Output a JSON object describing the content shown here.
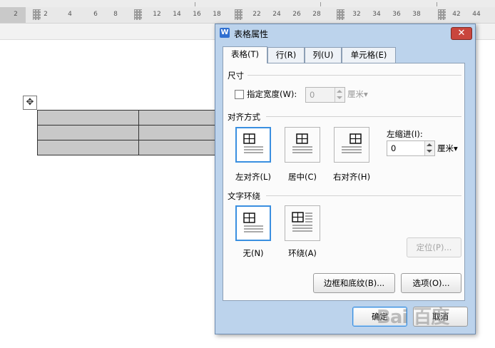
{
  "ruler": {
    "labels": [
      "2",
      "2",
      "4",
      "6",
      "8",
      "12",
      "14",
      "16",
      "18",
      "22",
      "24",
      "26",
      "28",
      "32",
      "34",
      "36",
      "38",
      "42",
      "44"
    ]
  },
  "document": {
    "move_handle_glyph": "✥",
    "table_rows": 3,
    "table_cols": 2
  },
  "dialog": {
    "app_icon": "W",
    "title": "表格属性",
    "close_glyph": "✕",
    "tabs": [
      {
        "label": "表格(T)",
        "active": true
      },
      {
        "label": "行(R)",
        "active": false
      },
      {
        "label": "列(U)",
        "active": false
      },
      {
        "label": "单元格(E)",
        "active": false
      }
    ],
    "size_section": {
      "label": "尺寸",
      "checkbox_label": "指定宽度(W):",
      "width_value": "0",
      "unit": "厘米▾"
    },
    "align_section": {
      "label": "对齐方式",
      "options": [
        {
          "label": "左对齐(L)",
          "selected": true
        },
        {
          "label": "居中(C)",
          "selected": false
        },
        {
          "label": "右对齐(H)",
          "selected": false
        }
      ],
      "indent_label": "左缩进(I):",
      "indent_value": "0",
      "indent_unit": "厘米▾"
    },
    "wrap_section": {
      "label": "文字环绕",
      "options": [
        {
          "label": "无(N)",
          "selected": true
        },
        {
          "label": "环绕(A)",
          "selected": false
        }
      ],
      "position_button": "定位(P)..."
    },
    "buttons": {
      "borders": "边框和底纹(B)...",
      "options": "选项(O)...",
      "ok": "确定",
      "cancel": "取消"
    }
  },
  "watermark": {
    "text": "Bai 百度"
  }
}
